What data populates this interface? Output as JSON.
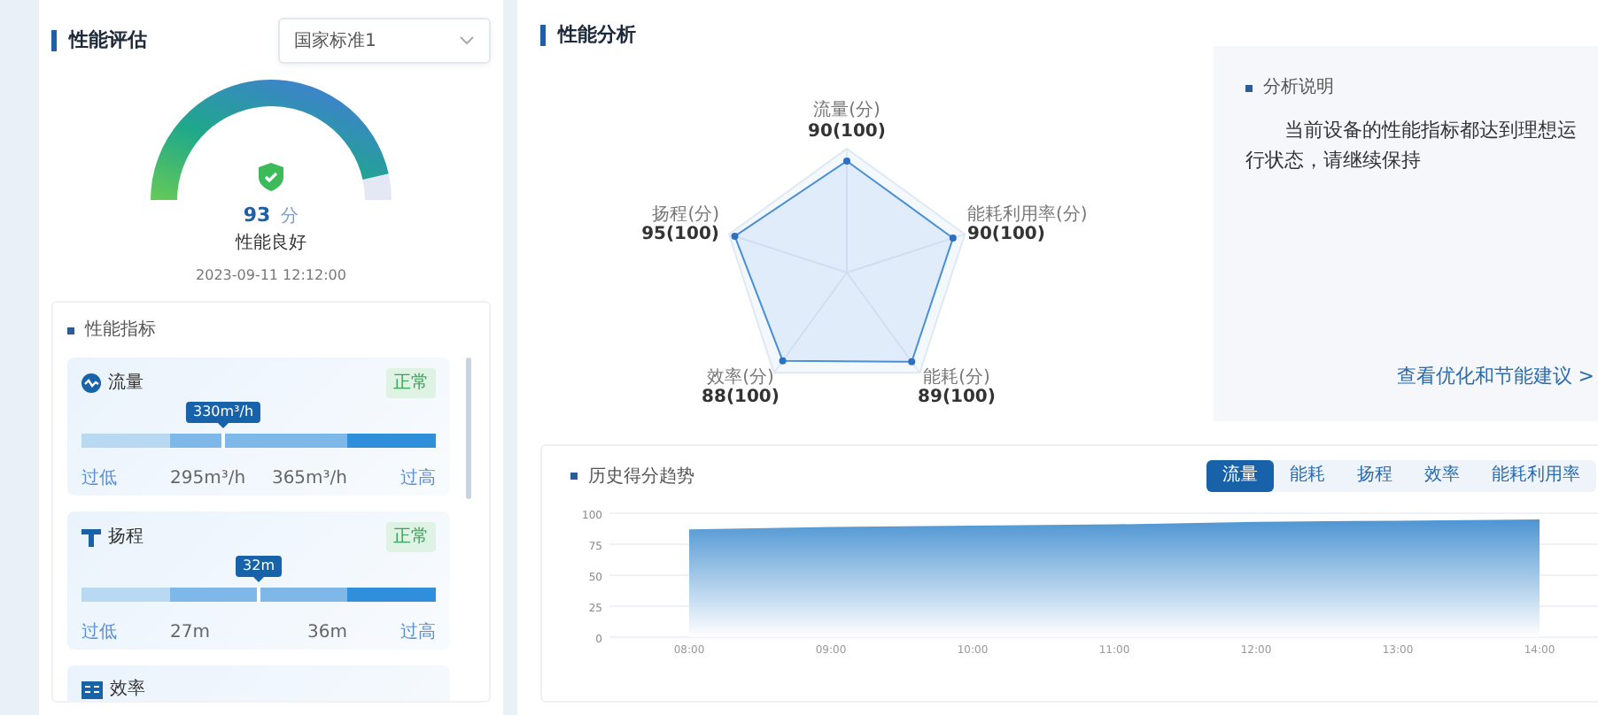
{
  "assessment": {
    "title": "性能评估",
    "standard_select": {
      "value": "国家标准1"
    },
    "gauge": {
      "score": "93",
      "unit": "分",
      "status": "性能良好",
      "time": "2023-09-11 12:12:00"
    },
    "indicators": {
      "title": "性能指标",
      "items": [
        {
          "kind": "flow",
          "name": "流量",
          "status": "正常",
          "reading": "330m³/h",
          "level": 0.4,
          "low_label": "过低",
          "min": "295m³/h",
          "max": "365m³/h",
          "high_label": "过高"
        },
        {
          "kind": "head",
          "name": "扬程",
          "status": "正常",
          "reading": "32m",
          "level": 0.5,
          "low_label": "过低",
          "min": "27m",
          "max": "36m",
          "high_label": "过高"
        },
        {
          "kind": "efficiency",
          "name": "效率"
        }
      ]
    }
  },
  "analysis": {
    "title": "性能分析",
    "radar": {
      "axes": [
        {
          "name": "流量(分)",
          "score": "90(100)"
        },
        {
          "name": "扬程(分)",
          "score": "95(100)"
        },
        {
          "name": "能耗利用率(分)",
          "score": "90(100)"
        },
        {
          "name": "效率(分)",
          "score": "88(100)"
        },
        {
          "name": "能耗(分)",
          "score": "89(100)"
        }
      ]
    },
    "note": {
      "title": "分析说明",
      "text": "当前设备的性能指标都达到理想运行状态，请继续保持",
      "link": "查看优化和节能建议 >"
    }
  },
  "history": {
    "title": "历史得分趋势",
    "tabs": [
      {
        "label": "流量",
        "selected": true
      },
      {
        "label": "能耗",
        "selected": false
      },
      {
        "label": "扬程",
        "selected": false
      },
      {
        "label": "效率",
        "selected": false
      },
      {
        "label": "能耗利用率",
        "selected": false
      }
    ],
    "chart_data": {
      "type": "area",
      "categories": [
        "08:00",
        "09:00",
        "10:00",
        "11:00",
        "12:00",
        "13:00",
        "14:00"
      ],
      "values": [
        87,
        89,
        90,
        91,
        93,
        94,
        95
      ],
      "ylim": [
        0,
        100
      ],
      "grid": true,
      "yticks": [
        0,
        25,
        50,
        75,
        100
      ]
    }
  }
}
